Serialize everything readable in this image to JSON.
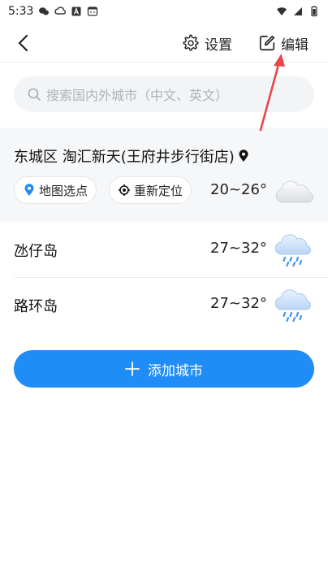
{
  "status_bar": {
    "time": "5:33",
    "icons": [
      "wechat-icon",
      "cloud-icon",
      "a-icon",
      "face-icon",
      "wifi-icon",
      "signal-icon",
      "battery-icon"
    ]
  },
  "header": {
    "back_icon": "chevron-left-icon",
    "settings_label": "设置",
    "settings_icon": "gear-icon",
    "edit_label": "编辑",
    "edit_icon": "edit-icon"
  },
  "search": {
    "placeholder": "搜索国内外城市（中文、英文）"
  },
  "current_location": {
    "name": "东城区 淘汇新天(王府井步行街店)",
    "map_select_label": "地图选点",
    "relocate_label": "重新定位",
    "temp_range": "20~26°",
    "weather_icon": "cloudy-icon"
  },
  "cities": [
    {
      "name": "氹仔岛",
      "temp_range": "27~32°",
      "weather_icon": "rain-icon"
    },
    {
      "name": "路环岛",
      "temp_range": "27~32°",
      "weather_icon": "rain-icon"
    }
  ],
  "add_city": {
    "label": "添加城市"
  },
  "colors": {
    "accent": "#1f8cf7",
    "annotation_arrow": "#e5484d"
  }
}
